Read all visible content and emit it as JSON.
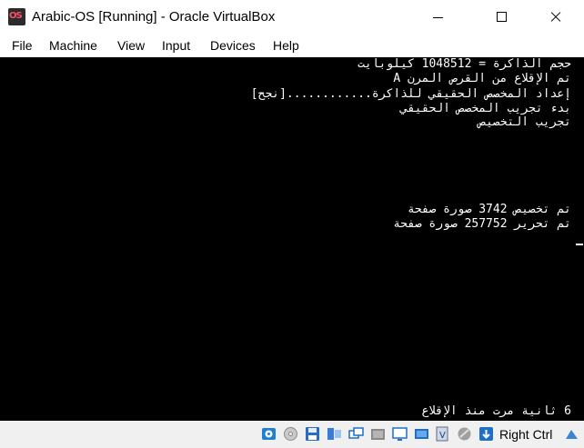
{
  "window": {
    "title": "Arabic-OS [Running] - Oracle VirtualBox",
    "icon_text": "OS"
  },
  "menu": [
    "File",
    "Machine",
    "View",
    "Input",
    "Devices",
    "Help"
  ],
  "console": {
    "lines": [
      "حجم الذاكرة = 1048512 كيلوبايت",
      "تم الإقلاع من  القرص المرن A",
      "إعداد المخصص الحقيقي للذاكرة............[نجح]",
      "بدء تجريب المخصص الحقيقي",
      "تجريب التخصيص",
      "تم تخصيص 3742 صورة صفحة",
      "تم تحرير 257752 صورة صفحة",
      "6 ثانية مرت منذ الإقلاع"
    ]
  },
  "statusbar": {
    "host_key": "Right Ctrl",
    "icons": [
      "hard-disk-icon",
      "optical-drive-icon",
      "floppy-icon",
      "audio-icon",
      "network-icon",
      "usb-icon",
      "shared-folder-icon",
      "display-icon",
      "video-capture-icon",
      "virtualization-icon",
      "mouse-integration-icon",
      "keyboard-capture-icon"
    ]
  }
}
